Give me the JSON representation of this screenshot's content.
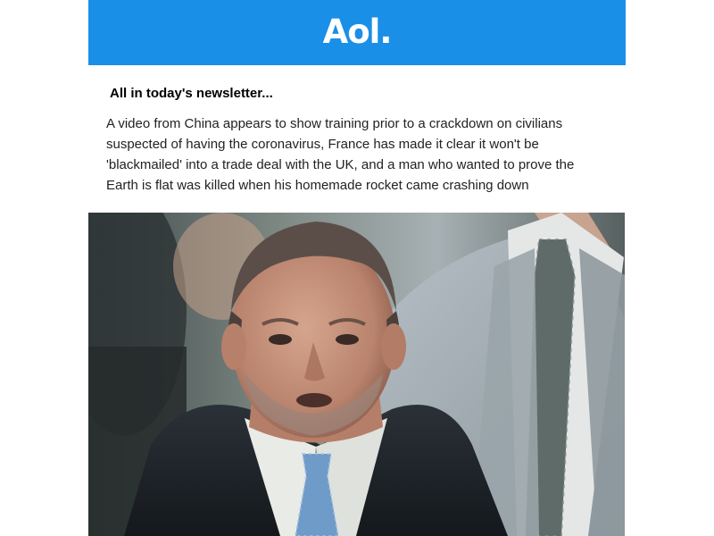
{
  "header": {
    "logo_text": "Aol.",
    "brand_color": "#1a8fe8"
  },
  "newsletter": {
    "heading": "All in today's newsletter...",
    "summary": "A video from China appears to show training prior to a crackdown on civilians suspected of having the coronavirus, France has made it clear it won't be 'blackmailed' into a trade deal with the UK, and a man who wanted to prove the Earth is flat was killed when his homemade rocket came crashing down"
  },
  "hero_image": {
    "subject": "photo-man-in-suit-and-tie"
  }
}
